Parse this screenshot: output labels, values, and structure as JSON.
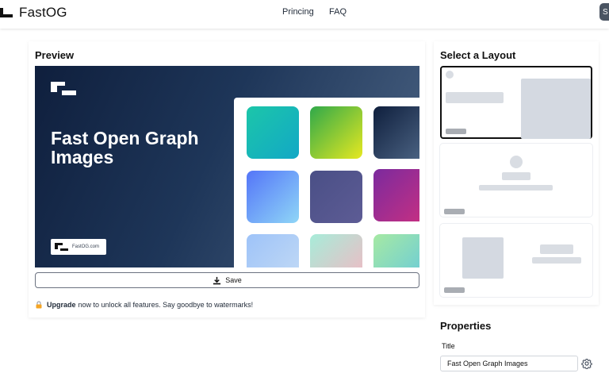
{
  "header": {
    "brand": "FastOG",
    "nav": [
      {
        "label": "Princing"
      },
      {
        "label": "FAQ"
      }
    ],
    "avatar_initial": "S"
  },
  "preview": {
    "heading": "Preview",
    "canvas": {
      "title": "Fast Open Graph Images",
      "watermark": "FastOG.com"
    },
    "save_label": "Save",
    "upgrade": {
      "strong": "Upgrade",
      "text": "now to unlock all features. Say goodbye to watermarks!"
    }
  },
  "layouts": {
    "heading": "Select a Layout",
    "options": [
      {
        "name": "layout-option-1",
        "selected": true
      },
      {
        "name": "layout-option-2",
        "selected": false
      },
      {
        "name": "layout-option-3",
        "selected": false
      }
    ]
  },
  "properties": {
    "heading": "Properties",
    "title_label": "Title",
    "title_value": "Fast Open Graph Images"
  },
  "icons": {
    "save": "download-icon",
    "lock": "lock-icon",
    "gear": "gear-icon"
  },
  "colors": {
    "canvas_gradient_start": "#0f1f3d",
    "canvas_gradient_end": "#4d6585",
    "text_primary": "#111111"
  }
}
